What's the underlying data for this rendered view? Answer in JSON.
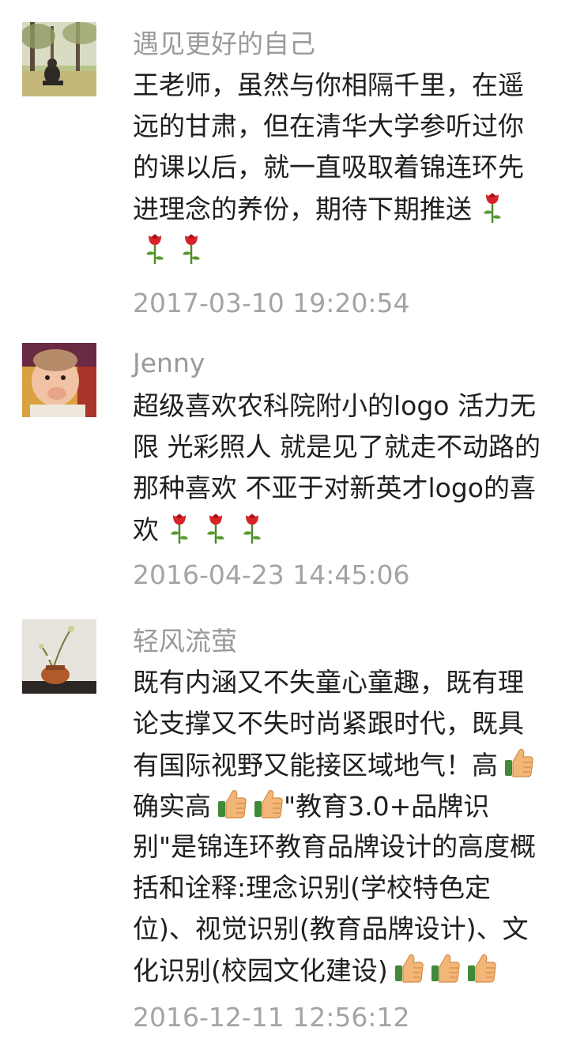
{
  "comments": [
    {
      "author": "遇见更好的自己",
      "avatar_icon": "park-photo-avatar",
      "lines": [
        {
          "text": "王老师，虽然与你相隔千里，在遥",
          "emojis": []
        },
        {
          "text": "远的甘肃，但在清华大学参听过你",
          "emojis": []
        },
        {
          "text": "的课以后，就一直吸取着锦连环先",
          "emojis": []
        },
        {
          "text": "进理念的养份，期待下期推送",
          "emojis": [
            "rose-emoji"
          ]
        },
        {
          "text": "",
          "emojis": [
            "rose-emoji",
            "rose-emoji"
          ]
        }
      ],
      "time": "2017-03-10 19:20:54"
    },
    {
      "author": "Jenny",
      "avatar_icon": "baby-photo-avatar",
      "lines": [
        {
          "text": "超级喜欢农科院附小的logo 活力无",
          "emojis": []
        },
        {
          "text": "限 光彩照人 就是见了就走不动路的",
          "emojis": []
        },
        {
          "text": "那种喜欢 不亚于对新英才logo的喜",
          "emojis": []
        },
        {
          "text": "欢",
          "emojis": [
            "rose-emoji",
            "rose-emoji",
            "rose-emoji"
          ]
        }
      ],
      "time": "2016-04-23 14:45:06"
    },
    {
      "author": "轻风流萤",
      "avatar_icon": "ikebana-photo-avatar",
      "lines": [
        {
          "text": "既有内涵又不失童心童趣，既有理",
          "emojis": []
        },
        {
          "text": "论支撑又不失时尚紧跟时代，既具",
          "emojis": []
        },
        {
          "text": "有国际视野又能接区域地气！高",
          "emojis": [
            "thumbs-up-emoji"
          ]
        },
        {
          "text": "确实高",
          "emojis": [
            "thumbs-up-emoji",
            "thumbs-up-emoji"
          ],
          "after": "\"教育3.0+品牌识"
        },
        {
          "text": "别\"是锦连环教育品牌设计的高度概",
          "emojis": []
        },
        {
          "text": "括和诠释:理念识别(学校特色定",
          "emojis": []
        },
        {
          "text": "位)、视觉识别(教育品牌设计)、文",
          "emojis": []
        },
        {
          "text": "化识别(校园文化建设)",
          "emojis": [
            "thumbs-up-emoji",
            "thumbs-up-emoji",
            "thumbs-up-emoji"
          ]
        }
      ],
      "time": "2016-12-11 12:56:12"
    }
  ],
  "colors": {
    "author": "#9a9a9a",
    "body": "#1f1f1f",
    "time": "#a4a4a4",
    "background": "#ffffff"
  }
}
